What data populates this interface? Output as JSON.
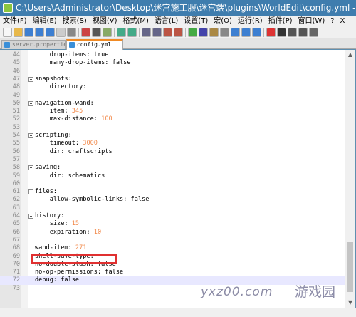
{
  "window": {
    "title": "C:\\Users\\Administrator\\Desktop\\迷宫施工服\\迷宫端\\plugins\\WorldEdit\\config.yml -..."
  },
  "menu": [
    "文件(F)",
    "编辑(E)",
    "搜索(S)",
    "视图(V)",
    "格式(M)",
    "语言(L)",
    "设置(T)",
    "宏(O)",
    "运行(R)",
    "插件(P)",
    "窗口(W)",
    "?",
    "X"
  ],
  "tabs": [
    {
      "label": "server.properties"
    },
    {
      "label": "config.yml"
    }
  ],
  "lines": [
    {
      "n": "44",
      "text": "    drop-items: true"
    },
    {
      "n": "45",
      "text": "    many-drop-items: false"
    },
    {
      "n": "46",
      "text": ""
    },
    {
      "n": "47",
      "text": "snapshots:"
    },
    {
      "n": "48",
      "text": "    directory:"
    },
    {
      "n": "49",
      "text": ""
    },
    {
      "n": "50",
      "text": "navigation-wand:"
    },
    {
      "n": "51",
      "text": "    item: ",
      "value": "345"
    },
    {
      "n": "52",
      "text": "    max-distance: ",
      "value": "100"
    },
    {
      "n": "53",
      "text": ""
    },
    {
      "n": "54",
      "text": "scripting:"
    },
    {
      "n": "55",
      "text": "    timeout: ",
      "value": "3000"
    },
    {
      "n": "56",
      "text": "    dir: craftscripts"
    },
    {
      "n": "57",
      "text": ""
    },
    {
      "n": "58",
      "text": "saving:"
    },
    {
      "n": "59",
      "text": "    dir: schematics"
    },
    {
      "n": "60",
      "text": ""
    },
    {
      "n": "61",
      "text": "files:"
    },
    {
      "n": "62",
      "text": "    allow-symbolic-links: false"
    },
    {
      "n": "63",
      "text": ""
    },
    {
      "n": "64",
      "text": "history:"
    },
    {
      "n": "65",
      "text": "    size: ",
      "value": "15"
    },
    {
      "n": "66",
      "text": "    expiration: ",
      "value": "10"
    },
    {
      "n": "67",
      "text": ""
    },
    {
      "n": "68",
      "text": "wand-item: ",
      "value": "271"
    },
    {
      "n": "69",
      "text": "shell-save-type:"
    },
    {
      "n": "70",
      "text": "no-double-slash: false"
    },
    {
      "n": "71",
      "text": "no-op-permissions: false"
    },
    {
      "n": "72",
      "text": "debug: false"
    },
    {
      "n": "73",
      "text": ""
    }
  ],
  "colors": {
    "accent": "#f08a24",
    "number": "#f2894a",
    "highlight_box": "#e03030"
  },
  "watermark": {
    "text": "yxz00.com",
    "cn": "游戏园"
  }
}
